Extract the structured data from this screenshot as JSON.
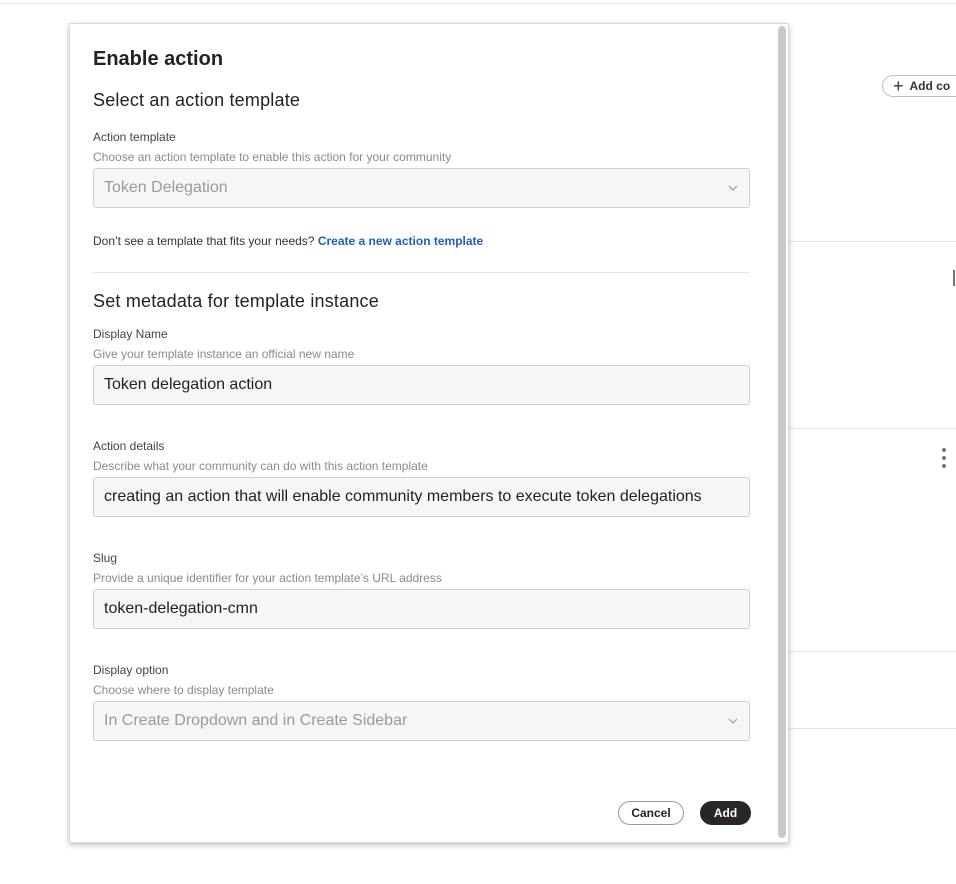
{
  "background": {
    "add_button_label": "Add co"
  },
  "modal": {
    "title": "Enable action",
    "section_template": {
      "heading": "Select an action template",
      "action_template": {
        "label": "Action template",
        "help": "Choose an action template to enable this action for your community",
        "selected": "Token Delegation"
      },
      "hint_text": "Don’t see a template that fits your needs?",
      "hint_link": "Create a new action template"
    },
    "section_metadata": {
      "heading": "Set metadata for template instance",
      "display_name": {
        "label": "Display Name",
        "help": "Give your template instance an official new name",
        "value": "Token delegation action"
      },
      "action_details": {
        "label": "Action details",
        "help": "Describe what your community can do with this action template",
        "value": "creating an action that will enable community members to execute token delegations"
      },
      "slug": {
        "label": "Slug",
        "help": "Provide a unique identifier for your action template’s URL address",
        "value": "token-delegation-cmn"
      },
      "display_option": {
        "label": "Display option",
        "help": "Choose where to display template",
        "selected": "In Create Dropdown and in Create Sidebar"
      }
    },
    "buttons": {
      "cancel": "Cancel",
      "add": "Add"
    }
  },
  "icons": {
    "chevron": "chevron-down-icon",
    "plus": "plus-icon",
    "kebab": "kebab-menu-icon"
  },
  "colors": {
    "link": "#1f5fbf",
    "primary_button": "#2a2628"
  }
}
